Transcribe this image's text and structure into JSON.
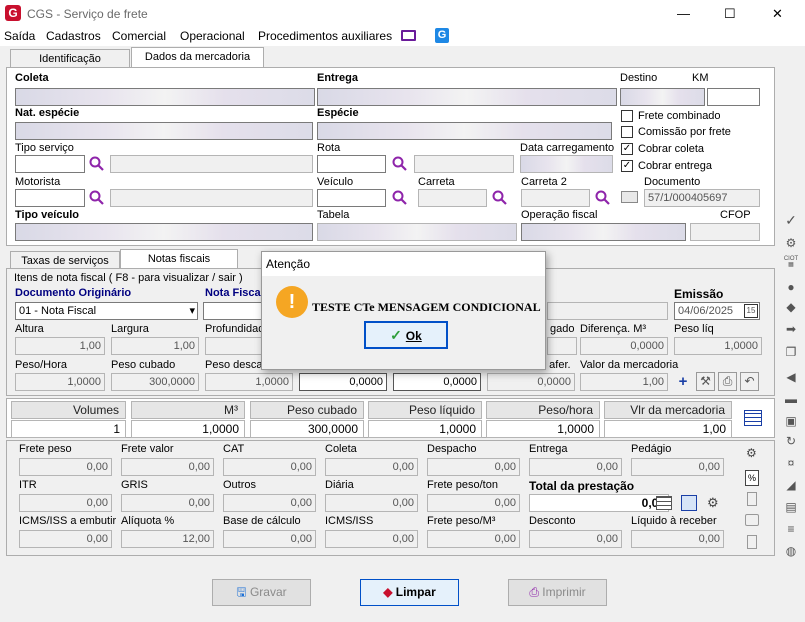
{
  "window": {
    "title": "CGS - Serviço de frete",
    "logo": "G",
    "min": "—",
    "max": "☐",
    "close": "✕"
  },
  "menu": [
    "Saída",
    "Cadastros",
    "Comercial",
    "Operacional",
    "Procedimentos auxiliares"
  ],
  "menu_icons": [
    "monitor-icon",
    "app-g-icon"
  ],
  "tabs_top": [
    "Identificação",
    "Dados da mercadoria"
  ],
  "top": {
    "coleta": "Coleta",
    "entrega": "Entrega",
    "destino": "Destino",
    "km": "KM",
    "nat_especie": "Nat. espécie",
    "especie": "Espécie",
    "tipo_servico": "Tipo serviço",
    "rota": "Rota",
    "data_carregamento": "Data carregamento",
    "motorista": "Motorista",
    "veiculo": "Veículo",
    "carreta": "Carreta",
    "carreta2": "Carreta 2",
    "documento": "Documento",
    "documento_value": "57/1/000405697",
    "tipo_veiculo": "Tipo veículo",
    "tabela": "Tabela",
    "operacao_fiscal": "Operação fiscal",
    "cfop": "CFOP",
    "checkboxes": [
      {
        "label": "Frete combinado",
        "checked": false
      },
      {
        "label": "Comissão por frete",
        "checked": false
      },
      {
        "label": "Cobrar coleta",
        "checked": true
      },
      {
        "label": "Cobrar entrega",
        "checked": true
      }
    ]
  },
  "tabs_mid": [
    "Taxas de serviços",
    "Notas fiscais"
  ],
  "nf": {
    "group_title": "Itens de nota fiscal ( F8 - para visualizar / sair )",
    "doc_orig": "Documento Originário",
    "doc_orig_value": "01 - Nota Fiscal",
    "nota_fiscal": "Nota Fisca",
    "emissao": "Emissão",
    "emissao_value": "04/06/2025",
    "altura": "Altura",
    "altura_v": "1,00",
    "largura": "Largura",
    "largura_v": "1,00",
    "profundidade": "Profundidad",
    "pesado": "gado",
    "diferenca": "Diferença. M³",
    "diferenca_v": "0,0000",
    "peso_liq": "Peso líq",
    "peso_liq_v": "1,0000",
    "peso_hora": "Peso/Hora",
    "peso_hora_v": "1,0000",
    "peso_cubado": "Peso cubado",
    "peso_cubado_v": "300,0000",
    "peso_descarga": "Peso descar",
    "peso_descarga_v": "1,0000",
    "v4": "0,0000",
    "v5": "0,0000",
    "v6": "0,0000",
    "aferido": "o afer.",
    "valor_merc": "Valor da mercadoria",
    "valor_merc_v": "1,00"
  },
  "totals": {
    "headers": [
      "Volumes",
      "M³",
      "Peso cubado",
      "Peso líquido",
      "Peso/hora",
      "Vlr da mercadoria"
    ],
    "values": [
      "1",
      "1,0000",
      "300,0000",
      "1,0000",
      "1,0000",
      "1,00"
    ]
  },
  "freight": {
    "r1": [
      {
        "l": "Frete peso",
        "v": "0,00"
      },
      {
        "l": "Frete valor",
        "v": "0,00"
      },
      {
        "l": "CAT",
        "v": "0,00"
      },
      {
        "l": "Coleta",
        "v": "0,00"
      },
      {
        "l": "Despacho",
        "v": "0,00"
      },
      {
        "l": "Entrega",
        "v": "0,00"
      },
      {
        "l": "Pedágio",
        "v": "0,00"
      }
    ],
    "r2": [
      {
        "l": "ITR",
        "v": "0,00"
      },
      {
        "l": "GRIS",
        "v": "0,00"
      },
      {
        "l": "Outros",
        "v": "0,00"
      },
      {
        "l": "Diária",
        "v": "0,00"
      },
      {
        "l": "Frete peso/ton",
        "v": "0,00"
      },
      {
        "l": "Total da prestação",
        "v": "0,00"
      }
    ],
    "r3": [
      {
        "l": "ICMS/ISS a embutir",
        "v": "0,00"
      },
      {
        "l": "Alíquota %",
        "v": "12,00"
      },
      {
        "l": "Base de cálculo",
        "v": "0,00"
      },
      {
        "l": "ICMS/ISS",
        "v": "0,00"
      },
      {
        "l": "Frete peso/M³",
        "v": "0,00"
      },
      {
        "l": "Desconto",
        "v": "0,00"
      },
      {
        "l": "Líquido à receber",
        "v": "0,00"
      }
    ]
  },
  "buttons": {
    "gravar": "Gravar",
    "limpar": "Limpar",
    "imprimir": "Imprimir"
  },
  "dialog": {
    "title": "Atenção",
    "message": "TESTE CTe MENSAGEM CONDICIONAL",
    "ok": "Ok",
    "icon": "!"
  },
  "colors": {
    "accent_blue": "#000080",
    "warning": "#f5a623",
    "brand": "#c8102e"
  }
}
